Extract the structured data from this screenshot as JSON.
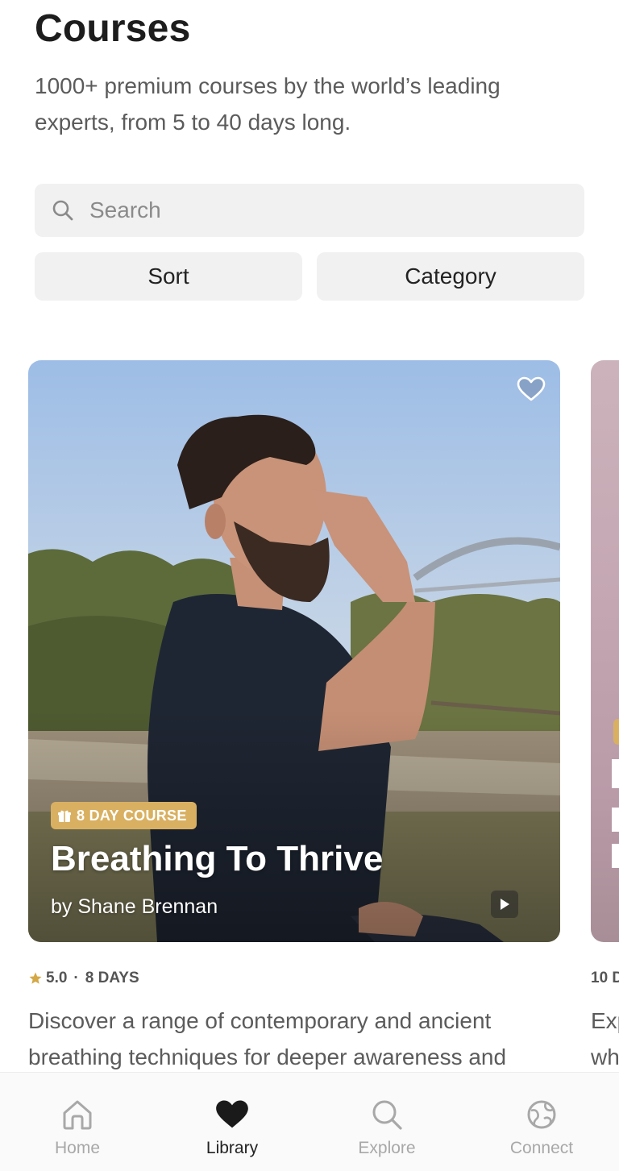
{
  "header": {
    "title": "Courses",
    "subtitle": "1000+ premium courses by the world’s leading experts, from 5 to 40 days long."
  },
  "search": {
    "placeholder": "Search",
    "value": ""
  },
  "filters": {
    "sort_label": "Sort",
    "category_label": "Category"
  },
  "featured_course": {
    "badge": "8 DAY COURSE",
    "title": "Breathing To Thrive",
    "author": "by Shane Brennan",
    "rating": "5.0",
    "separator": "·",
    "duration": "8 DAYS",
    "description": "Discover a range of contemporary and ancient breathing techniques for deeper awareness and"
  },
  "next_course_peek": {
    "meta": "10 D",
    "description": "Exp\nwh"
  },
  "tabbar": {
    "items": [
      {
        "label": "Home",
        "icon": "home-icon",
        "active": false
      },
      {
        "label": "Library",
        "icon": "heart-icon",
        "active": true
      },
      {
        "label": "Explore",
        "icon": "search-icon",
        "active": false
      },
      {
        "label": "Connect",
        "icon": "globe-icon",
        "active": false
      }
    ]
  },
  "colors": {
    "badge": "#d9b061",
    "star": "#d4a847",
    "inactive_tab": "#a8a8a8",
    "active_tab": "#222222"
  }
}
